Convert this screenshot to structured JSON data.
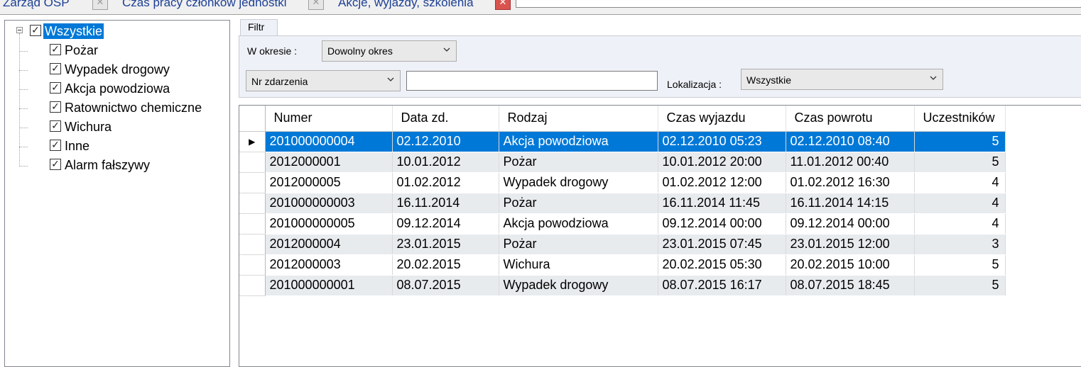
{
  "tabs": [
    {
      "label": "Zarząd OSP",
      "active": false
    },
    {
      "label": "Czas pracy członków jednostki",
      "active": false
    },
    {
      "label": "Akcje, wyjazdy, szkolenia",
      "active": true
    }
  ],
  "tree": {
    "root": {
      "label": "Wszystkie",
      "checked": true,
      "selected": true
    },
    "items": [
      {
        "label": "Pożar",
        "checked": true
      },
      {
        "label": "Wypadek drogowy",
        "checked": true
      },
      {
        "label": "Akcja powodziowa",
        "checked": true
      },
      {
        "label": "Ratownictwo chemiczne",
        "checked": true
      },
      {
        "label": "Wichura",
        "checked": true
      },
      {
        "label": "Inne",
        "checked": true
      },
      {
        "label": "Alarm fałszywy",
        "checked": true
      }
    ]
  },
  "filter": {
    "tab_label": "Filtr",
    "period_label": "W okresie :",
    "period_value": "Dowolny okres",
    "field_value": "Nr zdarzenia",
    "search_value": "",
    "location_label": "Lokalizacja :",
    "location_value": "Wszystkie"
  },
  "grid": {
    "columns": [
      "Numer",
      "Data zd.",
      "Rodzaj",
      "Czas wyjazdu",
      "Czas powrotu",
      "Uczestników"
    ],
    "selected_row": 0,
    "current_row_marker": "▶",
    "rows": [
      [
        "201000000004",
        "02.12.2010",
        "Akcja powodziowa",
        "02.12.2010 05:23",
        "02.12.2010 08:40",
        "5"
      ],
      [
        "2012000001",
        "10.01.2012",
        "Pożar",
        "10.01.2012 20:00",
        "11.01.2012 00:40",
        "5"
      ],
      [
        "2012000005",
        "01.02.2012",
        "Wypadek drogowy",
        "01.02.2012 12:00",
        "01.02.2012 16:30",
        "4"
      ],
      [
        "201000000003",
        "16.11.2014",
        "Pożar",
        "16.11.2014 11:45",
        "16.11.2014 14:15",
        "4"
      ],
      [
        "201000000005",
        "09.12.2014",
        "Akcja powodziowa",
        "09.12.2014 00:00",
        "09.12.2014 00:00",
        "4"
      ],
      [
        "2012000004",
        "23.01.2015",
        "Pożar",
        "23.01.2015 07:45",
        "23.01.2015 12:00",
        "3"
      ],
      [
        "2012000003",
        "20.02.2015",
        "Wichura",
        "20.02.2015 05:30",
        "20.02.2015 10:00",
        "5"
      ],
      [
        "201000000001",
        "08.07.2015",
        "Wypadek drogowy",
        "08.07.2015 16:17",
        "08.07.2015 18:45",
        "5"
      ]
    ]
  },
  "colors": {
    "selection": "#0078d7",
    "tab_text": "#1c3f94",
    "alt_row": "#e8ebee"
  }
}
